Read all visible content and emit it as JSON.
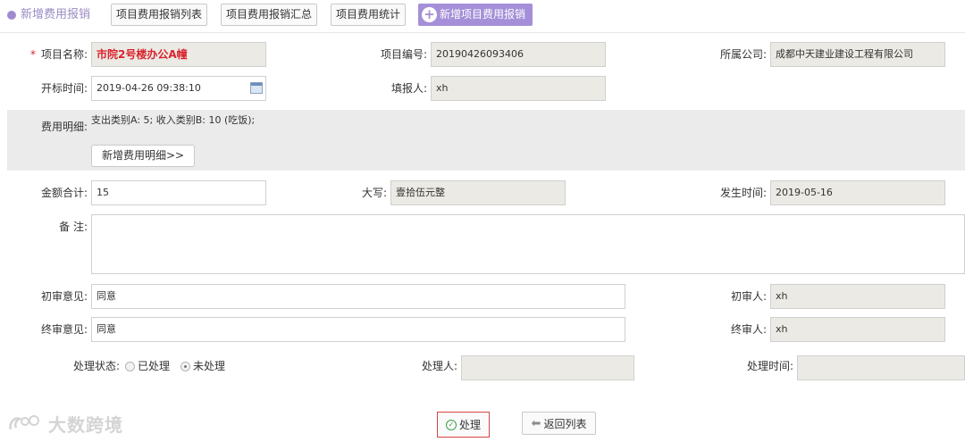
{
  "header": {
    "title": "新增费用报销",
    "tabs": [
      {
        "label": "项目费用报销列表"
      },
      {
        "label": "项目费用报销汇总"
      },
      {
        "label": "项目费用统计"
      }
    ],
    "add_button": "新增项目费用报销"
  },
  "form": {
    "project_name": {
      "label": "项目名称:",
      "required_mark": "*",
      "value": "市院2号楼办公A幢"
    },
    "project_code": {
      "label": "项目编号:",
      "value": "20190426093406"
    },
    "company": {
      "label": "所属公司:",
      "value": "成都中天建业建设工程有限公司"
    },
    "bid_time": {
      "label": "开标时间:",
      "value": "2019-04-26 09:38:10"
    },
    "reporter": {
      "label": "填报人:",
      "value": "xh"
    },
    "expense_detail": {
      "label": "费用明细:",
      "text": "支出类别A: 5; 收入类别B: 10 (吃饭);",
      "add_button": "新增费用明细>>"
    },
    "total_amount": {
      "label": "金额合计:",
      "value": "15"
    },
    "amount_upper": {
      "label": "大写:",
      "value": "壹拾伍元整"
    },
    "occur_time": {
      "label": "发生时间:",
      "value": "2019-05-16"
    },
    "remark": {
      "label": "备 注:",
      "value": ""
    },
    "first_opinion": {
      "label": "初审意见:",
      "value": "同意"
    },
    "first_reviewer": {
      "label": "初审人:",
      "value": "xh"
    },
    "final_opinion": {
      "label": "终审意见:",
      "value": "同意"
    },
    "final_reviewer": {
      "label": "终审人:",
      "value": "xh"
    },
    "process_status": {
      "label": "处理状态:",
      "options": [
        {
          "label": "已处理",
          "selected": false
        },
        {
          "label": "未处理",
          "selected": true
        }
      ]
    },
    "processor": {
      "label": "处理人:",
      "value": ""
    },
    "process_time": {
      "label": "处理时间:",
      "value": ""
    }
  },
  "actions": {
    "process": "处理",
    "back": "返回列表"
  },
  "watermark": {
    "text": "大数跨境"
  },
  "colors": {
    "accent": "#a58fd8",
    "required": "#d9232d",
    "readonly_bg": "#ebeae4",
    "band_bg": "#ebebeb"
  }
}
